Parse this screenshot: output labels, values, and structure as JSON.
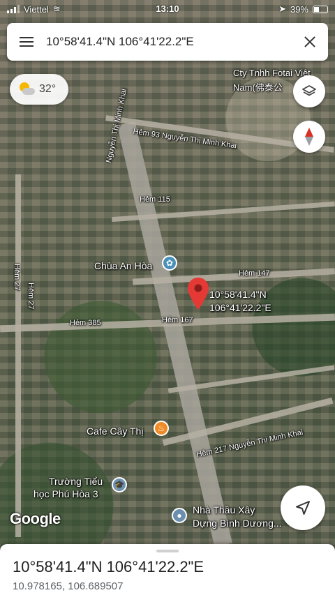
{
  "status_bar": {
    "carrier": "Viettel",
    "time": "13:10",
    "battery": "39%"
  },
  "search": {
    "query": "10°58'41.4\"N 106°41'22.2\"E"
  },
  "weather": {
    "temperature": "32°",
    "icon": "partly-cloudy-icon"
  },
  "map": {
    "labels": {
      "nguyen_thi_minh_khai": "Nguyễn Thị Minh Khai",
      "cty_tnhh_line1": "Cty Tnhh Fotai Việt",
      "cty_tnhh_line2": "Nam(佛泰公",
      "hem_93": "Hẻm 93 Nguyễn Thị Minh Khai",
      "hem_115": "Hẻm 115",
      "hem_27_a": "Hẻm 27",
      "hem_27_b": "Hẻm 27",
      "chua_an_hoa": "Chùa An Hòa",
      "hem_147": "Hẻm 147",
      "hem_385": "Hẻm 385",
      "hem_167": "Hẻm 167",
      "pin_line1": "10°58'41.4\"N",
      "pin_line2": "106°41'22.2\"E",
      "cafe_cay_thi": "Cafe Cây Thị",
      "hem_217": "Hẻm 217 Nguyễn Thị Minh Khai",
      "truong_line1": "Trường Tiểu",
      "truong_line2": "học Phú Hòa 3",
      "nha_thau_line1": "Nhà Thầu Xây",
      "nha_thau_line2": "Dựng Bình Dương..."
    },
    "attribution": "Google"
  },
  "bottom_sheet": {
    "title": "10°58'41.4\"N 106°41'22.2\"E",
    "decimal_coords": "10.978165, 106.689507"
  },
  "colors": {
    "pin": "#e53935",
    "poi_temple": "#4a90b8",
    "poi_cafe": "#f08a24",
    "poi_school": "#6c8fb0",
    "poi_place": "#6c8fb0",
    "compass_red": "#d93025"
  }
}
